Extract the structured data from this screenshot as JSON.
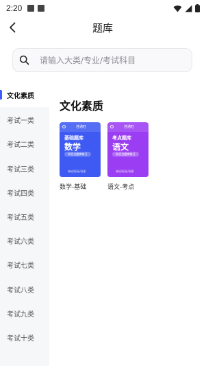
{
  "status_bar": {
    "time": "2:20",
    "icons": [
      "image-icon",
      "text-a-icon",
      "wifi-icon",
      "signal-icon",
      "battery-icon"
    ]
  },
  "header": {
    "title": "题库",
    "back_icon": "chevron-left-icon"
  },
  "search": {
    "placeholder": "请输入大类/专业/考试科目",
    "icon": "search-icon"
  },
  "sidebar": {
    "active_index": 0,
    "accent_color": "#3e5cff",
    "items": [
      {
        "label": "文化素质"
      },
      {
        "label": "考试一类"
      },
      {
        "label": "考试二类"
      },
      {
        "label": "考试三类"
      },
      {
        "label": "考试四类"
      },
      {
        "label": "考试五类"
      },
      {
        "label": "考试六类"
      },
      {
        "label": "考试七类"
      },
      {
        "label": "考试八类"
      },
      {
        "label": "考试九类"
      },
      {
        "label": "考试十类"
      }
    ]
  },
  "content": {
    "section_title": "文化素质",
    "cards": [
      {
        "brand": "佳通旺",
        "top_text": "基础题库",
        "main_text": "数学",
        "pill_text": "知识点题库练习",
        "footer_text": "单招/职高/高职",
        "label": "数学-基础",
        "color": "#3f5af2"
      },
      {
        "brand": "佳通旺",
        "top_text": "考点题库",
        "main_text": "语文",
        "pill_text": "知识点题库练习",
        "footer_text": "单招/职高/高职",
        "label": "语文-考点",
        "color": "#9b3ef3"
      }
    ]
  }
}
